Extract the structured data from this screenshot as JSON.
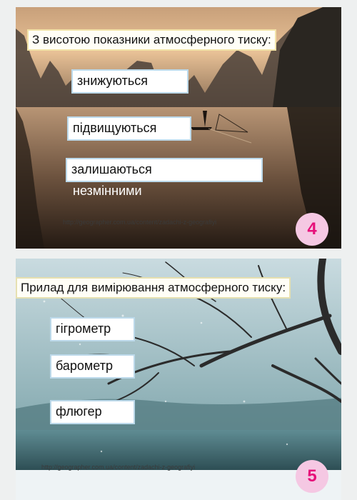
{
  "slide4": {
    "question": "З висотою показники атмосферного тиску:",
    "options": [
      "знижуються",
      "підвищуються",
      "залишаються"
    ],
    "option3_continuation": "незмінними",
    "url": "http://geographer.com.ua/content/zadachi-z-geografiyi",
    "number": "4",
    "icons": [
      "mountain-lake-background"
    ]
  },
  "slide5": {
    "question": "Прилад для вимірювання атмосферного тиску:",
    "options": [
      "гігрометр",
      "барометр",
      "флюгер"
    ],
    "url": "http://geographer.com.ua/content/zadachi-z-geografiyi",
    "number": "5",
    "icons": [
      "winter-tree-background"
    ]
  },
  "colors": {
    "badge_bg": "#f5c8e3",
    "badge_text": "#e6107a"
  }
}
